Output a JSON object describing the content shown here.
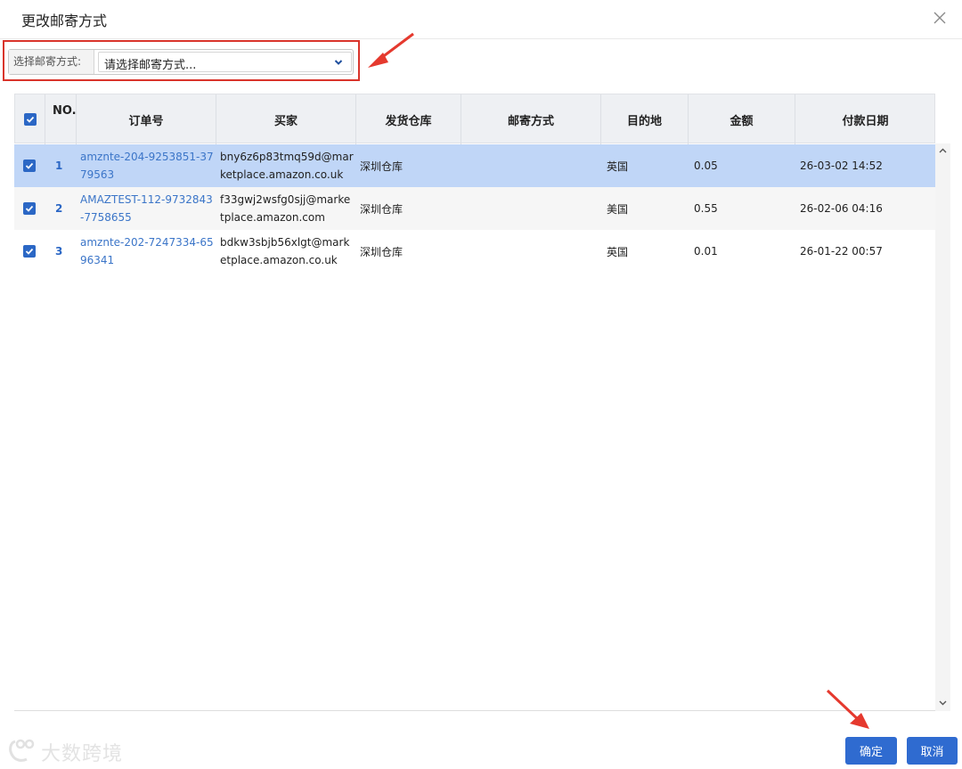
{
  "dialog": {
    "title": "更改邮寄方式"
  },
  "selector": {
    "label": "选择邮寄方式:",
    "value": "请选择邮寄方式..."
  },
  "table": {
    "headers": [
      "NO.",
      "订单号",
      "买家",
      "发货仓库",
      "邮寄方式",
      "目的地",
      "金额",
      "付款日期"
    ],
    "rows": [
      {
        "no": "1",
        "order": "amznte-204-9253851-3779563",
        "buyer": "bny6z6p83tmq59d@marketplace.amazon.co.uk",
        "warehouse": "深圳仓库",
        "shipping": "",
        "destination": "英国",
        "amount": "0.05",
        "date": "26-03-02 14:52",
        "checked": true,
        "selected": true
      },
      {
        "no": "2",
        "order": "AMAZTEST-112-9732843-7758655",
        "buyer": "f33gwj2wsfg0sjj@marketplace.amazon.com",
        "warehouse": "深圳仓库",
        "shipping": "",
        "destination": "美国",
        "amount": "0.55",
        "date": "26-02-06 04:16",
        "checked": true,
        "selected": false
      },
      {
        "no": "3",
        "order": "amznte-202-7247334-6596341",
        "buyer": "bdkw3sbjb56xlgt@marketplace.amazon.co.uk",
        "warehouse": "深圳仓库",
        "shipping": "",
        "destination": "英国",
        "amount": "0.01",
        "date": "26-01-22 00:57",
        "checked": true,
        "selected": false
      }
    ]
  },
  "footer": {
    "logo_text": "大数跨境",
    "confirm_label": "确定",
    "cancel_label": "取消"
  },
  "colors": {
    "accent": "#2f6bd0",
    "selected_row": "#c0d6f7",
    "alt_row": "#f6f6f6",
    "annotation": "#d9342b"
  },
  "icons": {
    "close": "close-icon",
    "dropdown": "chevron-down-icon",
    "check": "check-icon"
  }
}
